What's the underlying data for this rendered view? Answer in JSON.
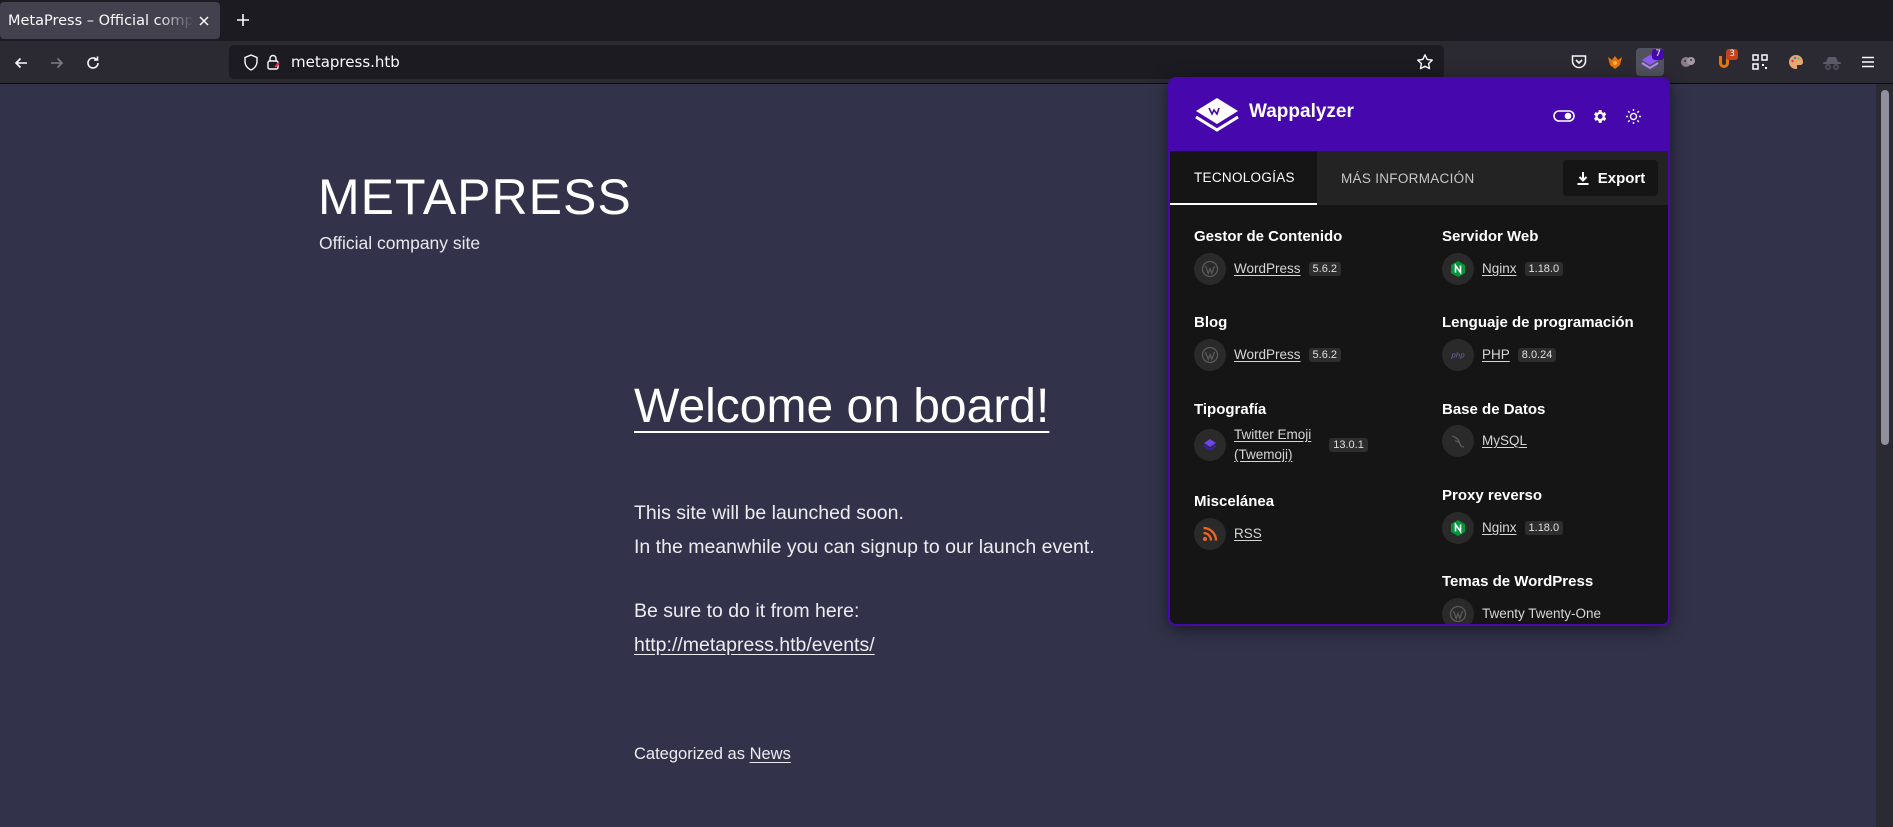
{
  "browser": {
    "tab": {
      "title": "MetaPress – Official company site",
      "close_icon": "close-icon"
    },
    "new_tab_icon": "plus-icon",
    "nav": {
      "back_icon": "arrow-left-icon",
      "forward_icon": "arrow-right-icon",
      "reload_icon": "reload-icon"
    },
    "url": "metapress.htb",
    "extensions": [
      {
        "name": "pocket-icon"
      },
      {
        "name": "foxyproxy-icon"
      },
      {
        "name": "wappalyzer-icon",
        "badge": "7",
        "active": true
      },
      {
        "name": "cookie-icon"
      },
      {
        "name": "ublock-icon",
        "badge": "3"
      },
      {
        "name": "qr-icon"
      },
      {
        "name": "palette-icon"
      },
      {
        "name": "incognito-icon"
      },
      {
        "name": "menu-icon"
      }
    ]
  },
  "site": {
    "title": "METAPRESS",
    "description": "Official company site",
    "entry_title": "Welcome on board!",
    "lines": [
      "This site will be launched soon.",
      "In the meanwhile you can signup to our launch event.",
      "Be sure to do it from here:",
      "http://metapress.htb/events/"
    ],
    "categorized_prefix": "Categorized as",
    "category": "News"
  },
  "wappalyzer": {
    "name": "Wappalyzer",
    "header_icons": [
      "toggle-icon",
      "gear-icon",
      "sun-icon"
    ],
    "tabs": [
      "TECNOLOGÍAS",
      "MÁS INFORMACIÓN"
    ],
    "export_label": "Export",
    "categories_left": [
      {
        "title": "Gestor de Contenido",
        "techs": [
          {
            "name": "WordPress",
            "version": "5.6.2",
            "icon": "wordpress-icon"
          }
        ]
      },
      {
        "title": "Blog",
        "techs": [
          {
            "name": "WordPress",
            "version": "5.6.2",
            "icon": "wordpress-icon"
          }
        ]
      },
      {
        "title": "Tipografía",
        "techs": [
          {
            "name": "Twitter Emoji (Twemoji)",
            "name_line1": "Twitter Emoji",
            "name_line2": "(Twemoji)",
            "version": "13.0.1",
            "icon": "twemoji-icon"
          }
        ]
      },
      {
        "title": "Miscelánea",
        "techs": [
          {
            "name": "RSS",
            "version": "",
            "icon": "rss-icon"
          }
        ]
      }
    ],
    "categories_right": [
      {
        "title": "Servidor Web",
        "techs": [
          {
            "name": "Nginx",
            "version": "1.18.0",
            "icon": "nginx-icon"
          }
        ]
      },
      {
        "title": "Lenguaje de programación",
        "techs": [
          {
            "name": "PHP",
            "version": "8.0.24",
            "icon": "php-icon"
          }
        ]
      },
      {
        "title": "Base de Datos",
        "techs": [
          {
            "name": "MySQL",
            "version": "",
            "icon": "mysql-icon"
          }
        ]
      },
      {
        "title": "Proxy reverso",
        "techs": [
          {
            "name": "Nginx",
            "version": "1.18.0",
            "icon": "nginx-icon"
          }
        ]
      },
      {
        "title": "Temas de WordPress",
        "techs": [
          {
            "name": "Twenty Twenty-One",
            "version": "",
            "icon": "wordpress-icon"
          }
        ]
      }
    ]
  },
  "colors": {
    "accent": "#4608ad",
    "page_bg": "#32324a",
    "popup_bg": "#151515"
  }
}
